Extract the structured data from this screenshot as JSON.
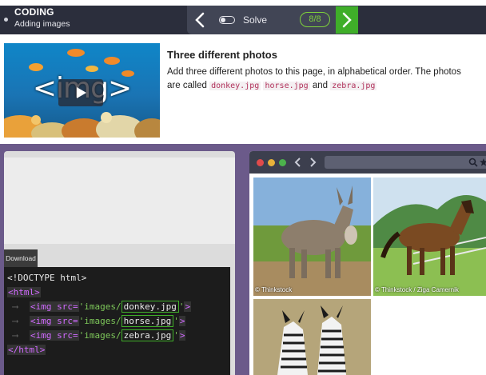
{
  "header": {
    "brand": "CODING",
    "subtitle": "Adding images",
    "solve_label": "Solve",
    "progress": "8/8"
  },
  "hero": {
    "overlay_text": "<img>"
  },
  "intro": {
    "title": "Three different photos",
    "text_before": "Add three different photos to this page, in alphabetical order. The photos are called ",
    "files": [
      "donkey.jpg",
      "horse.jpg",
      "zebra.jpg"
    ],
    "and_word": "and"
  },
  "editor": {
    "download_label": "Download",
    "doctype": "<!DOCTYPE html>",
    "html_open": "<html>",
    "html_close": "</html>",
    "img_prefix": "<img src=",
    "quote_path": "'images/",
    "quote_close": "'",
    "tag_end": ">",
    "images": [
      "donkey.jpg",
      "horse.jpg",
      "zebra.jpg"
    ]
  },
  "preview": {
    "credits": [
      "© Thinkstock",
      "© Thinkstock / Ziga Camernik"
    ]
  },
  "colors": {
    "topbar": "#2b2e3c",
    "accent_green": "#3fae29",
    "workarea": "#6b5a8a"
  }
}
